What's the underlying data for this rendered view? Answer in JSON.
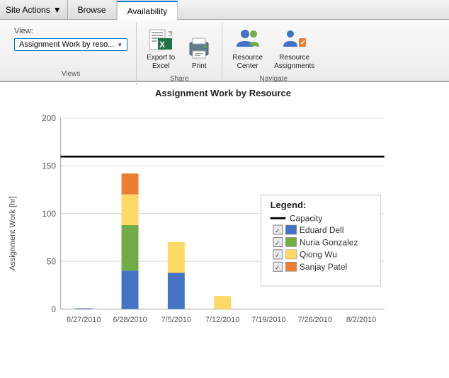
{
  "topbar": {
    "site_actions_label": "Site Actions",
    "dropdown_arrow": "▼",
    "browse_label": "Browse",
    "availability_label": "Availability"
  },
  "ribbon": {
    "view_label": "View:",
    "view_value": "Assignment Work by reso...",
    "views_section_label": "Views",
    "share_section_label": "Share",
    "navigate_section_label": "Navigate",
    "export_to_excel_label": "Export to\nExcel",
    "print_label": "Print",
    "resource_center_label": "Resource\nCenter",
    "resource_assignments_label": "Resource\nAssignments"
  },
  "chart": {
    "title": "Assignment Work by Resource",
    "y_axis_label": "Assignment Work [hr]",
    "capacity_line_value": 160,
    "y_max": 200,
    "y_ticks": [
      0,
      50,
      100,
      150,
      200
    ],
    "x_labels": [
      "6/27/2010",
      "6/28/2010",
      "7/5/2010",
      "7/12/2010",
      "7/19/2010",
      "7/26/2010",
      "8/2/2010"
    ],
    "bars": [
      {
        "x_label": "6/27/2010",
        "segments": [
          {
            "value": 0,
            "color": "#4472C4"
          },
          {
            "value": 0,
            "color": "#70AD47"
          },
          {
            "value": 0,
            "color": "#FFD966"
          },
          {
            "value": 0,
            "color": "#ED7D31"
          }
        ],
        "total": 1
      },
      {
        "x_label": "6/28/2010",
        "segments": [
          {
            "value": 40,
            "color": "#4472C4"
          },
          {
            "value": 48,
            "color": "#70AD47"
          },
          {
            "value": 32,
            "color": "#FFD966"
          },
          {
            "value": 22,
            "color": "#ED7D31"
          }
        ],
        "total": 142
      },
      {
        "x_label": "7/5/2010",
        "segments": [
          {
            "value": 38,
            "color": "#4472C4"
          },
          {
            "value": 0,
            "color": "#70AD47"
          },
          {
            "value": 32,
            "color": "#FFD966"
          },
          {
            "value": 0,
            "color": "#ED7D31"
          }
        ],
        "total": 72
      },
      {
        "x_label": "7/12/2010",
        "segments": [
          {
            "value": 0,
            "color": "#4472C4"
          },
          {
            "value": 0,
            "color": "#70AD47"
          },
          {
            "value": 14,
            "color": "#FFD966"
          },
          {
            "value": 0,
            "color": "#ED7D31"
          }
        ],
        "total": 16
      },
      {
        "x_label": "7/19/2010",
        "segments": [],
        "total": 0
      },
      {
        "x_label": "7/26/2010",
        "segments": [],
        "total": 0
      },
      {
        "x_label": "8/2/2010",
        "segments": [],
        "total": 0
      }
    ],
    "legend": {
      "title": "Legend:",
      "capacity_label": "Capacity",
      "items": [
        {
          "color": "#4472C4",
          "label": "Eduard Dell"
        },
        {
          "color": "#70AD47",
          "label": "Nuria Gonzalez"
        },
        {
          "color": "#FFD966",
          "label": "Qiong Wu"
        },
        {
          "color": "#ED7D31",
          "label": "Sanjay Patel"
        }
      ]
    }
  }
}
